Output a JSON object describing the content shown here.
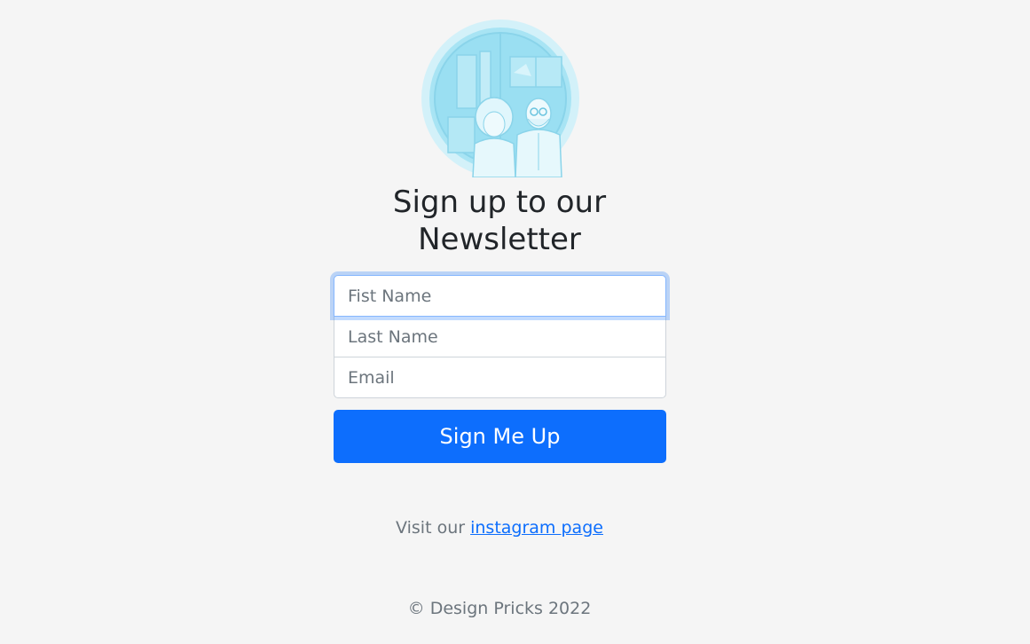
{
  "header": {
    "title_line1": "Sign up to our",
    "title_line2": "Newsletter"
  },
  "form": {
    "first_name_placeholder": "Fist Name",
    "last_name_placeholder": "Last Name",
    "email_placeholder": "Email",
    "submit_label": "Sign Me Up"
  },
  "footer": {
    "visit_prefix": "Visit our",
    "instagram_link": "instagram page",
    "copyright": "© Design Pricks 2022"
  },
  "colors": {
    "background": "#f5f5f5",
    "primary": "#0d6efd",
    "logo_light": "#cfeff8",
    "logo_mid": "#a9e3f3",
    "logo_dark": "#7ccfe8"
  },
  "icons": {
    "logo": "newsletter-people-illustration"
  }
}
